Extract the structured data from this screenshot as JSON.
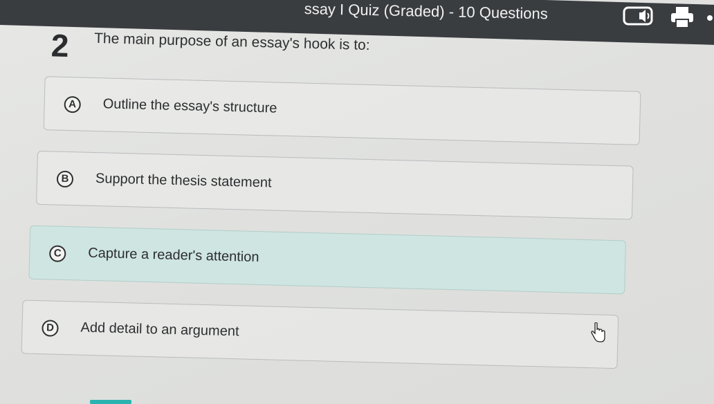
{
  "header": {
    "title": "ssay I Quiz (Graded) - 10 Questions",
    "speaker_icon": "speaker-icon",
    "printer_icon": "printer-icon"
  },
  "question": {
    "number": "2",
    "text": "The main purpose of an essay's hook is to:"
  },
  "options": [
    {
      "letter": "A",
      "text": "Outline the essay's structure",
      "selected": false
    },
    {
      "letter": "B",
      "text": "Support the thesis statement",
      "selected": false
    },
    {
      "letter": "C",
      "text": "Capture a reader's attention",
      "selected": true
    },
    {
      "letter": "D",
      "text": "Add detail to an argument",
      "selected": false
    }
  ],
  "colors": {
    "header_bg": "#3a3d40",
    "selected_bg": "#cfe5e1",
    "accent": "#2bb3b0"
  }
}
